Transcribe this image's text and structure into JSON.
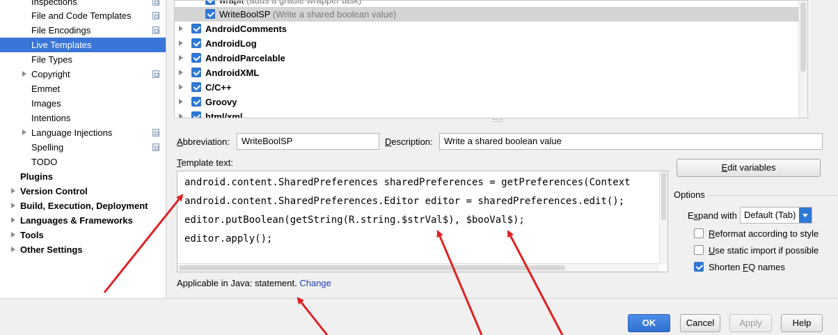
{
  "sidebar": {
    "items": [
      {
        "label": "Inspections",
        "level": "child",
        "icon": true
      },
      {
        "label": "File and Code Templates",
        "level": "child",
        "icon": true
      },
      {
        "label": "File Encodings",
        "level": "child",
        "icon": true
      },
      {
        "label": "Live Templates",
        "level": "child",
        "selected": true
      },
      {
        "label": "File Types",
        "level": "child"
      },
      {
        "label": "Copyright",
        "level": "child",
        "expandable": true,
        "icon": true
      },
      {
        "label": "Emmet",
        "level": "child"
      },
      {
        "label": "Images",
        "level": "child"
      },
      {
        "label": "Intentions",
        "level": "child"
      },
      {
        "label": "Language Injections",
        "level": "child",
        "expandable": true,
        "icon": true
      },
      {
        "label": "Spelling",
        "level": "child",
        "icon": true
      },
      {
        "label": "TODO",
        "level": "child"
      },
      {
        "label": "Plugins",
        "level": "top"
      },
      {
        "label": "Version Control",
        "level": "top",
        "expandable": true
      },
      {
        "label": "Build, Execution, Deployment",
        "level": "top",
        "expandable": true
      },
      {
        "label": "Languages & Frameworks",
        "level": "top",
        "expandable": true
      },
      {
        "label": "Tools",
        "level": "top",
        "expandable": true
      },
      {
        "label": "Other Settings",
        "level": "top",
        "expandable": true
      }
    ]
  },
  "template_tree": {
    "templates": [
      {
        "name": "wrapIt",
        "description": "(adds a gradle wrapper task)"
      },
      {
        "name": "WriteBoolSP",
        "description": "(Write a shared  boolean value)",
        "selected": true
      }
    ],
    "groups": [
      "AndroidComments",
      "AndroidLog",
      "AndroidParcelable",
      "AndroidXML",
      "C/C++",
      "Groovy",
      "html/xml"
    ]
  },
  "abbreviation": {
    "label_prefix": "",
    "label_mnemonic": "A",
    "label_rest": "bbreviation:",
    "value": "WriteBoolSP"
  },
  "description": {
    "label_prefix": "",
    "label_mnemonic": "D",
    "label_rest": "escription:",
    "value": "Write a shared  boolean value"
  },
  "template_text": {
    "label_mnemonic": "T",
    "label_rest": "emplate text:",
    "lines": [
      "android.content.SharedPreferences sharedPreferences = getPreferences(Context",
      "android.content.SharedPreferences.Editor editor = sharedPreferences.edit();",
      "editor.putBoolean(getString(R.string.$strVal$), $booVal$);",
      "editor.apply();"
    ]
  },
  "applicable": {
    "text": "Applicable in Java: statement.",
    "change_link": "Change"
  },
  "edit_variables_button": {
    "mnemonic": "E",
    "rest": "dit variables"
  },
  "options": {
    "title": "Options",
    "expand_with": {
      "label_prefix": "E",
      "label_mnemonic": "x",
      "label_rest": "pand with",
      "value": "Default (Tab)"
    },
    "checkboxes": [
      {
        "mnemonic": "R",
        "rest": "eformat according to style",
        "checked": false
      },
      {
        "mnemonic": "U",
        "rest": "se static import if possible",
        "checked": false
      },
      {
        "prefix": "Shorten ",
        "mnemonic": "F",
        "rest": "Q names",
        "checked": true
      }
    ]
  },
  "buttons": {
    "ok": "OK",
    "cancel": "Cancel",
    "apply": "Apply",
    "help": "Help"
  },
  "colors": {
    "selection": "#3875d7",
    "annotation_arrow": "#e02020",
    "link": "#2040b8"
  }
}
